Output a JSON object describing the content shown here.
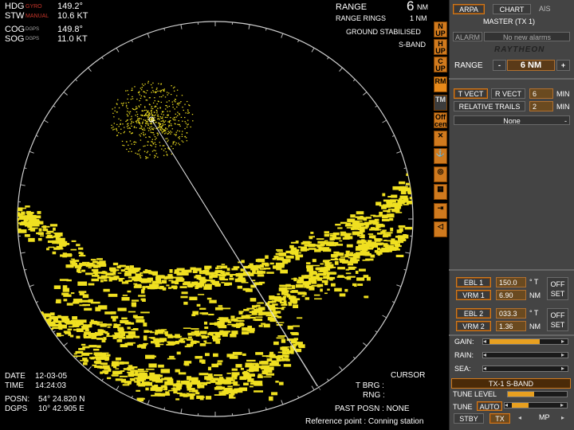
{
  "header_left": {
    "hdg_label": "HDG",
    "hdg_source": "GYRO",
    "hdg_value": "149.2°",
    "stw_label": "STW",
    "stw_source": "MANUAL",
    "stw_value": "10.6 KT",
    "cog_label": "COG",
    "cog_source": "DGPS",
    "cog_value": "149.8°",
    "sog_label": "SOG",
    "sog_source": "DGPS",
    "sog_value": "11.0 KT"
  },
  "header_right": {
    "range_label": "RANGE",
    "range_value": "6",
    "range_unit": "NM",
    "rings_label": "RANGE RINGS",
    "rings_value": "1 NM",
    "stab_mode": "GROUND STABILISED",
    "band": "S-BAND"
  },
  "footer_left": {
    "date_label": "DATE",
    "date_value": "12-03-05",
    "time_label": "TIME",
    "time_value": "14:24:03",
    "posn_label": "POSN:",
    "posn_value": "54° 24.820 N",
    "dgps_label": "DGPS",
    "dgps_value": "10° 42.905 E"
  },
  "footer_right": {
    "cursor_label": "CURSOR",
    "tbrg_label": "T BRG :",
    "rng_label": "RNG :",
    "past_posn": "PAST POSN : NONE",
    "reference": "Reference point : Conning station"
  },
  "icon_column": [
    {
      "name": "north-up-icon",
      "text": "N\nUP"
    },
    {
      "name": "head-up-icon",
      "text": "H\nUP"
    },
    {
      "name": "course-up-icon",
      "text": "C\nUP"
    },
    {
      "name": "relative-motion-icon",
      "text": "RM"
    },
    {
      "name": "true-motion-icon",
      "text": "TM"
    },
    {
      "name": "off-cent-icon",
      "text": "Off\ncent"
    },
    {
      "name": "cross-icon",
      "text": "✕"
    },
    {
      "name": "anchor-icon",
      "text": "⚓"
    },
    {
      "name": "target-icon",
      "text": "◎"
    },
    {
      "name": "map-icon",
      "text": "▦"
    },
    {
      "name": "exit-icon",
      "text": "⇥"
    },
    {
      "name": "speaker-mute-icon",
      "text": "◁"
    }
  ],
  "panel": {
    "tabs": [
      "ARPA",
      "CHART",
      "AIS"
    ],
    "master": "MASTER (TX 1)",
    "alarm_label": "ALARM",
    "alarm_text": "No new alarms",
    "brand": "RAYTHEON",
    "range_label": "RANGE",
    "range_minus": "-",
    "range_value": "6 NM",
    "range_plus": "+",
    "t_vect": "T VECT",
    "r_vect": "R VECT",
    "vect_value": "6",
    "vect_unit": "MIN",
    "relative_trails": "RELATIVE TRAILS",
    "trails_value": "2",
    "trails_unit": "MIN",
    "dropdown_value": "None",
    "ebl1": "EBL 1",
    "ebl1_value": "150.0",
    "ebl1_unit": "° T",
    "vrm1": "VRM 1",
    "vrm1_value": "6.90",
    "vrm1_unit": "NM",
    "offset1": "OFF\nSET",
    "ebl2": "EBL 2",
    "ebl2_value": "033.3",
    "ebl2_unit": "° T",
    "vrm2": "VRM 2",
    "vrm2_value": "1.36",
    "vrm2_unit": "NM",
    "offset2": "OFF\nSET",
    "gain_label": "GAIN:",
    "gain_level": 0.7,
    "rain_label": "RAIN:",
    "rain_level": 0,
    "sea_label": "SEA:",
    "sea_level": 0,
    "tx_label": "TX-1 S-BAND",
    "tune_level_label": "TUNE LEVEL",
    "tune_level": 0.45,
    "tune_label": "TUNE",
    "tune_mode": "AUTO",
    "tune_bar_level": 0.35,
    "stby": "STBY",
    "tx": "TX",
    "mp": "MP"
  },
  "colors": {
    "echo": "#f0e020",
    "accent": "#d07a1e",
    "panel_bg": "#444444",
    "field_bg": "#6a4a20"
  }
}
